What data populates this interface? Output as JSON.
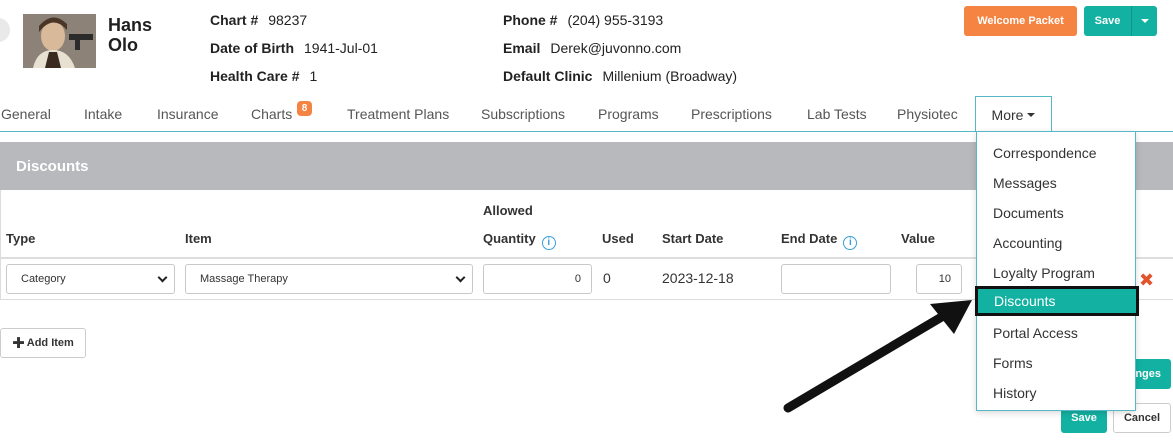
{
  "patient": {
    "first_name": "Hans",
    "last_name": "Olo",
    "chart_label": "Chart #",
    "chart_value": "98237",
    "dob_label": "Date of Birth",
    "dob_value": "1941-Jul-01",
    "hc_label": "Health Care #",
    "hc_value": "1",
    "phone_label": "Phone #",
    "phone_value": "(204) 955-3193",
    "email_label": "Email",
    "email_value": "Derek@juvonno.com",
    "clinic_label": "Default Clinic",
    "clinic_value": "Millenium (Broadway)"
  },
  "header_buttons": {
    "welcome_packet": "Welcome Packet",
    "save": "Save"
  },
  "tabs": [
    {
      "label": "General"
    },
    {
      "label": "Intake"
    },
    {
      "label": "Insurance"
    },
    {
      "label": "Charts",
      "badge": "8"
    },
    {
      "label": "Treatment Plans"
    },
    {
      "label": "Subscriptions"
    },
    {
      "label": "Programs"
    },
    {
      "label": "Prescriptions"
    },
    {
      "label": "Lab Tests"
    },
    {
      "label": "Physiotec"
    },
    {
      "label": "More"
    }
  ],
  "more_menu": {
    "items": [
      "Correspondence",
      "Messages",
      "Documents",
      "Accounting",
      "Loyalty Program",
      "Discounts",
      "Portal Access",
      "Forms",
      "History"
    ],
    "active": "Discounts"
  },
  "discounts": {
    "title": "Discounts",
    "columns": {
      "type": "Type",
      "item": "Item",
      "allowed": "Allowed",
      "quantity": "Quantity",
      "used": "Used",
      "start_date": "Start Date",
      "end_date": "End Date",
      "value": "Value"
    },
    "row": {
      "type": "Category",
      "item": "Massage Therapy",
      "quantity": "0",
      "used": "0",
      "start_date": "2023-12-18",
      "end_date": "",
      "value": "10"
    },
    "add_item": "Add Item"
  },
  "footer_buttons": {
    "changes_partial": "nges",
    "save": "Save",
    "cancel": "Cancel"
  },
  "colors": {
    "accent": "#13b1a2",
    "orange": "#f58442",
    "panel_header": "#b7b9bc",
    "delete": "#e2552c"
  }
}
